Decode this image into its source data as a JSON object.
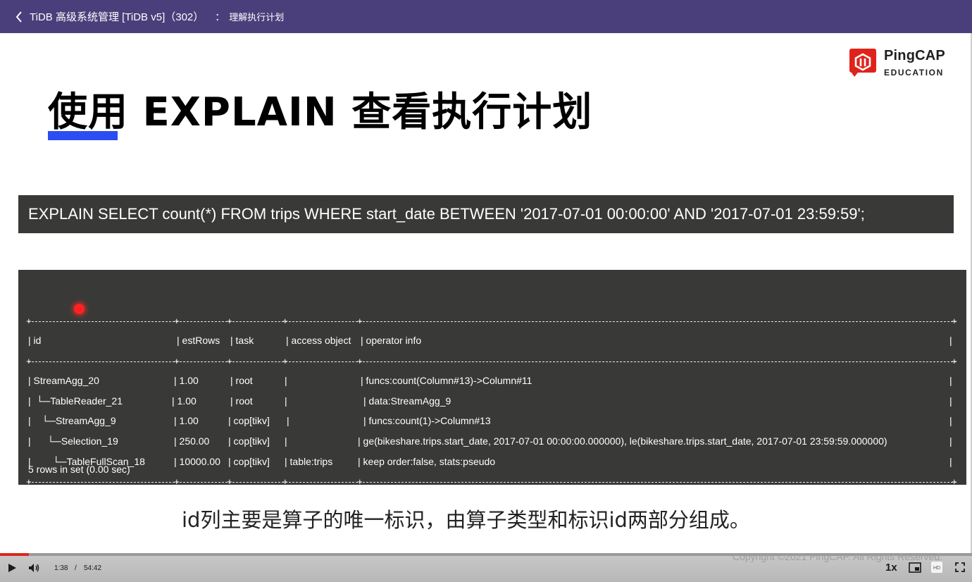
{
  "topbar": {
    "course_title": "TiDB 高级系统管理 [TiDB v5]（302）",
    "separator": "：",
    "lesson_title": "理解执行计划"
  },
  "logo": {
    "name": "PingCAP",
    "sub": "EDUCATION",
    "brand_color": "#e0231a"
  },
  "slide": {
    "title": "使用 EXPLAIN 查看执行计划",
    "accent_color": "#2b4df2",
    "sql": "EXPLAIN SELECT count(*) FROM trips WHERE start_date BETWEEN '2017-07-01 00:00:00' AND '2017-07-01 23:59:59';",
    "headers": [
      "| id",
      "| estRows",
      "| task",
      "| access object",
      "| operator info",
      "|"
    ],
    "rows": [
      [
        "| StreamAgg_20",
        "| 1.00",
        "| root",
        "|",
        "| funcs:count(Column#13)->Column#11",
        "|"
      ],
      [
        "|  └─TableReader_21",
        "| 1.00",
        "| root",
        "|",
        "| data:StreamAgg_9",
        "|"
      ],
      [
        "|    └─StreamAgg_9",
        "| 1.00",
        "| cop[tikv]",
        "|",
        "| funcs:count(1)->Column#13",
        "|"
      ],
      [
        "|      └─Selection_19",
        "| 250.00",
        "| cop[tikv]",
        "|",
        "| ge(bikeshare.trips.start_date, 2017-07-01 00:00:00.000000), le(bikeshare.trips.start_date, 2017-07-01 23:59:59.000000)",
        "|"
      ],
      [
        "|        └─TableFullScan_18",
        "| 10000.00",
        "| cop[tikv]",
        "| table:trips",
        "| keep order:false, stats:pseudo",
        "|"
      ]
    ],
    "footer": "5 rows in set (0.00 sec)",
    "subtitle": "id列主要是算子的唯一标识，由算子类型和标识id两部分组成。",
    "copyright": "Copyright ©2021 PingCAP. All Rights Reserved."
  },
  "player": {
    "current_time": "1:38",
    "time_separator": "/",
    "duration": "54:42",
    "progress_fraction": 0.03,
    "speed": "1x",
    "progress_color": "#e0241f",
    "icons": [
      "play-icon",
      "volume-icon",
      "pip-icon",
      "hd-icon",
      "fullscreen-icon"
    ]
  }
}
